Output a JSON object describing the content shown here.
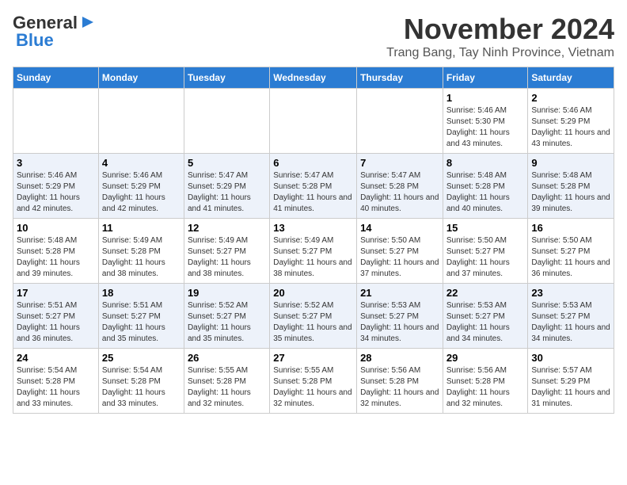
{
  "logo": {
    "general": "General",
    "blue": "Blue"
  },
  "header": {
    "month": "November 2024",
    "location": "Trang Bang, Tay Ninh Province, Vietnam"
  },
  "weekdays": [
    "Sunday",
    "Monday",
    "Tuesday",
    "Wednesday",
    "Thursday",
    "Friday",
    "Saturday"
  ],
  "weeks": [
    [
      {
        "day": "",
        "info": ""
      },
      {
        "day": "",
        "info": ""
      },
      {
        "day": "",
        "info": ""
      },
      {
        "day": "",
        "info": ""
      },
      {
        "day": "",
        "info": ""
      },
      {
        "day": "1",
        "info": "Sunrise: 5:46 AM\nSunset: 5:30 PM\nDaylight: 11 hours and 43 minutes."
      },
      {
        "day": "2",
        "info": "Sunrise: 5:46 AM\nSunset: 5:29 PM\nDaylight: 11 hours and 43 minutes."
      }
    ],
    [
      {
        "day": "3",
        "info": "Sunrise: 5:46 AM\nSunset: 5:29 PM\nDaylight: 11 hours and 42 minutes."
      },
      {
        "day": "4",
        "info": "Sunrise: 5:46 AM\nSunset: 5:29 PM\nDaylight: 11 hours and 42 minutes."
      },
      {
        "day": "5",
        "info": "Sunrise: 5:47 AM\nSunset: 5:29 PM\nDaylight: 11 hours and 41 minutes."
      },
      {
        "day": "6",
        "info": "Sunrise: 5:47 AM\nSunset: 5:28 PM\nDaylight: 11 hours and 41 minutes."
      },
      {
        "day": "7",
        "info": "Sunrise: 5:47 AM\nSunset: 5:28 PM\nDaylight: 11 hours and 40 minutes."
      },
      {
        "day": "8",
        "info": "Sunrise: 5:48 AM\nSunset: 5:28 PM\nDaylight: 11 hours and 40 minutes."
      },
      {
        "day": "9",
        "info": "Sunrise: 5:48 AM\nSunset: 5:28 PM\nDaylight: 11 hours and 39 minutes."
      }
    ],
    [
      {
        "day": "10",
        "info": "Sunrise: 5:48 AM\nSunset: 5:28 PM\nDaylight: 11 hours and 39 minutes."
      },
      {
        "day": "11",
        "info": "Sunrise: 5:49 AM\nSunset: 5:28 PM\nDaylight: 11 hours and 38 minutes."
      },
      {
        "day": "12",
        "info": "Sunrise: 5:49 AM\nSunset: 5:27 PM\nDaylight: 11 hours and 38 minutes."
      },
      {
        "day": "13",
        "info": "Sunrise: 5:49 AM\nSunset: 5:27 PM\nDaylight: 11 hours and 38 minutes."
      },
      {
        "day": "14",
        "info": "Sunrise: 5:50 AM\nSunset: 5:27 PM\nDaylight: 11 hours and 37 minutes."
      },
      {
        "day": "15",
        "info": "Sunrise: 5:50 AM\nSunset: 5:27 PM\nDaylight: 11 hours and 37 minutes."
      },
      {
        "day": "16",
        "info": "Sunrise: 5:50 AM\nSunset: 5:27 PM\nDaylight: 11 hours and 36 minutes."
      }
    ],
    [
      {
        "day": "17",
        "info": "Sunrise: 5:51 AM\nSunset: 5:27 PM\nDaylight: 11 hours and 36 minutes."
      },
      {
        "day": "18",
        "info": "Sunrise: 5:51 AM\nSunset: 5:27 PM\nDaylight: 11 hours and 35 minutes."
      },
      {
        "day": "19",
        "info": "Sunrise: 5:52 AM\nSunset: 5:27 PM\nDaylight: 11 hours and 35 minutes."
      },
      {
        "day": "20",
        "info": "Sunrise: 5:52 AM\nSunset: 5:27 PM\nDaylight: 11 hours and 35 minutes."
      },
      {
        "day": "21",
        "info": "Sunrise: 5:53 AM\nSunset: 5:27 PM\nDaylight: 11 hours and 34 minutes."
      },
      {
        "day": "22",
        "info": "Sunrise: 5:53 AM\nSunset: 5:27 PM\nDaylight: 11 hours and 34 minutes."
      },
      {
        "day": "23",
        "info": "Sunrise: 5:53 AM\nSunset: 5:27 PM\nDaylight: 11 hours and 34 minutes."
      }
    ],
    [
      {
        "day": "24",
        "info": "Sunrise: 5:54 AM\nSunset: 5:28 PM\nDaylight: 11 hours and 33 minutes."
      },
      {
        "day": "25",
        "info": "Sunrise: 5:54 AM\nSunset: 5:28 PM\nDaylight: 11 hours and 33 minutes."
      },
      {
        "day": "26",
        "info": "Sunrise: 5:55 AM\nSunset: 5:28 PM\nDaylight: 11 hours and 32 minutes."
      },
      {
        "day": "27",
        "info": "Sunrise: 5:55 AM\nSunset: 5:28 PM\nDaylight: 11 hours and 32 minutes."
      },
      {
        "day": "28",
        "info": "Sunrise: 5:56 AM\nSunset: 5:28 PM\nDaylight: 11 hours and 32 minutes."
      },
      {
        "day": "29",
        "info": "Sunrise: 5:56 AM\nSunset: 5:28 PM\nDaylight: 11 hours and 32 minutes."
      },
      {
        "day": "30",
        "info": "Sunrise: 5:57 AM\nSunset: 5:29 PM\nDaylight: 11 hours and 31 minutes."
      }
    ]
  ]
}
